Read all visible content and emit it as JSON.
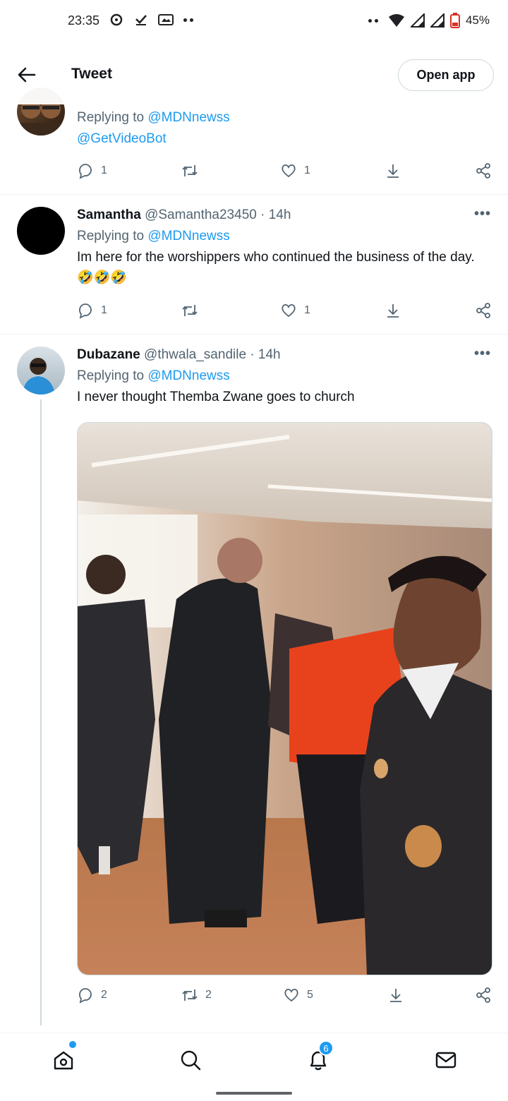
{
  "status_bar": {
    "time": "23:35",
    "battery": "45%",
    "left_icons": [
      "chat-bubble-icon",
      "check-icon",
      "gallery-icon",
      "more-dots-icon"
    ],
    "right_icons": [
      "more-dots-icon",
      "wifi-icon",
      "signal-icon",
      "signal-icon",
      "battery-icon"
    ]
  },
  "header": {
    "title": "Tweet",
    "open_app_label": "Open app"
  },
  "tweets": [
    {
      "reply_prefix": "Replying to ",
      "reply_to": "@MDNnewss",
      "text_link": "@GetVideoBot",
      "replies": "1",
      "retweets": "",
      "likes": "1"
    },
    {
      "name": "Samantha",
      "handle": "@Samantha23450",
      "time": "14h",
      "reply_prefix": "Replying to ",
      "reply_to": "@MDNnewss",
      "text": "Im here for  the worshippers who continued the business of the day. 🤣🤣🤣",
      "replies": "1",
      "retweets": "",
      "likes": "1"
    },
    {
      "name": "Dubazane",
      "handle": "@thwala_sandile",
      "time": "14h",
      "reply_prefix": "Replying to ",
      "reply_to": "@MDNnewss",
      "text": "I never thought Themba Zwane goes to church",
      "replies": "2",
      "retweets": "2",
      "likes": "5"
    }
  ],
  "bottom_nav": {
    "items": [
      "home-icon",
      "search-icon",
      "notifications-icon",
      "messages-icon"
    ],
    "notification_count": "6"
  },
  "colors": {
    "accent": "#1d9bf0",
    "text_primary": "#0f1419",
    "text_secondary": "#536471",
    "border": "#cfd9de"
  }
}
